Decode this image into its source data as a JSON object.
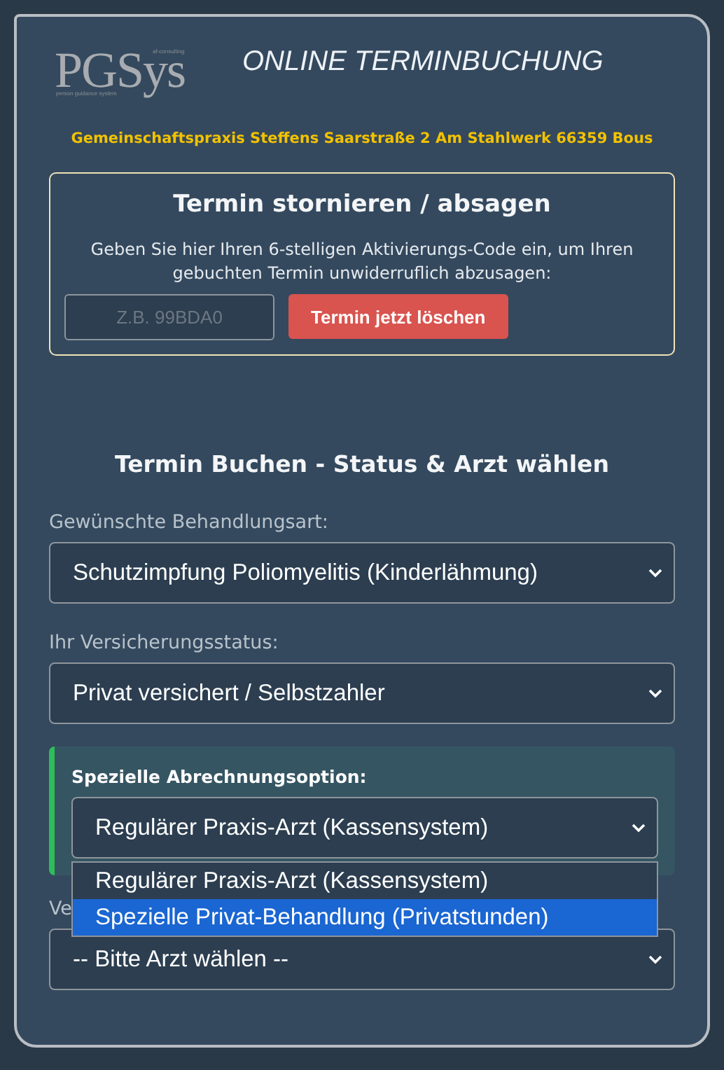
{
  "logo": {
    "wordmark": "PGSys",
    "superscript": "af-consulting",
    "tagline": "person guidance system"
  },
  "title": "ONLINE TERMINBUCHUNG",
  "address": "Gemeinschaftspraxis Steffens Saarstraße 2 Am Stahlwerk 66359 Bous",
  "cancel": {
    "heading": "Termin stornieren / absagen",
    "text": "Geben Sie hier Ihren 6-stelligen Aktivierungs-Code ein, um Ihren gebuchten Termin unwiderruflich abzusagen:",
    "code_field": {
      "placeholder": "Z.B. 99BDA0"
    },
    "button": "Termin jetzt löschen"
  },
  "booking": {
    "heading": "Termin Buchen - Status & Arzt wählen",
    "treatment": {
      "label": "Gewünschte Behandlungsart:",
      "value": "Schutzimpfung Poliomyelitis (Kinderlähmung)"
    },
    "insurance": {
      "label": "Ihr Versicherungsstatus:",
      "value": "Privat versichert / Selbstzahler"
    },
    "billing": {
      "label": "Spezielle Abrechnungsoption:",
      "value": "Regulärer Praxis-Arzt (Kassensystem)",
      "expanded": true,
      "options": [
        {
          "label": "Regulärer Praxis-Arzt (Kassensystem)",
          "highlighted": false
        },
        {
          "label": "Spezielle Privat-Behandlung (Privatstunden)",
          "highlighted": true
        }
      ]
    },
    "doctor": {
      "label": "Ve",
      "value": "-- Bitte Arzt wählen --"
    }
  }
}
